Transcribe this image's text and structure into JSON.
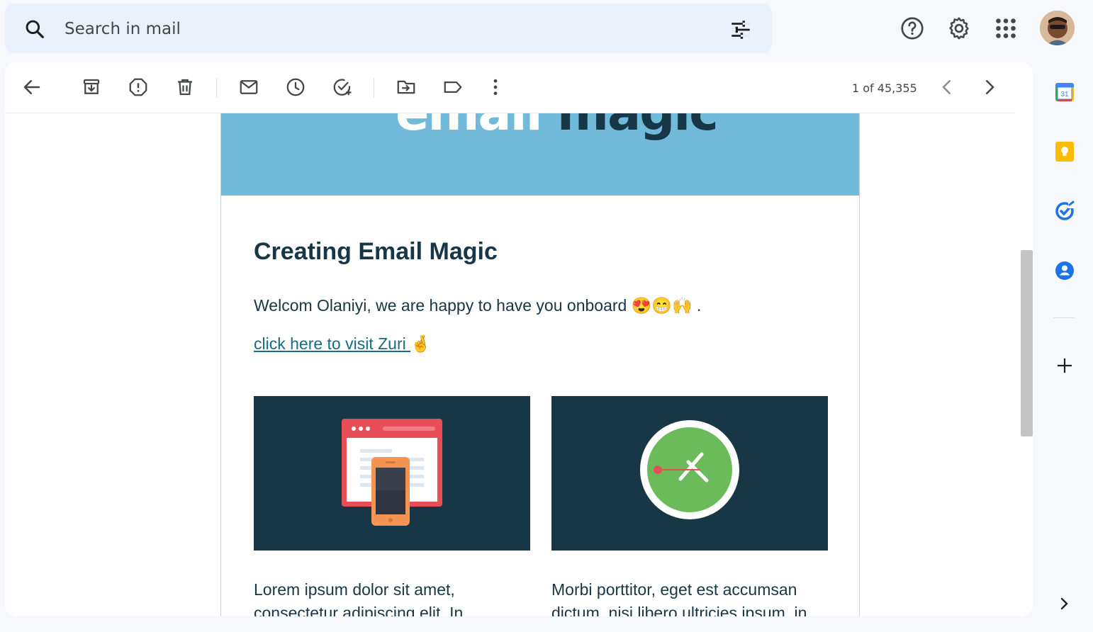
{
  "header": {
    "search_placeholder": "Search in mail",
    "icons": [
      "search-icon",
      "filter-options-icon",
      "help-icon",
      "settings-icon",
      "apps-grid-icon",
      "avatar"
    ]
  },
  "toolbar": {
    "pager_text": "1 of 45,355",
    "icons": [
      "back-arrow-icon",
      "archive-icon",
      "report-spam-icon",
      "delete-icon",
      "mark-unread-icon",
      "snooze-icon",
      "add-to-tasks-icon",
      "move-to-icon",
      "label-icon",
      "more-vert-icon",
      "prev-chevron-icon",
      "next-chevron-icon"
    ]
  },
  "email": {
    "banner": {
      "word_light": "email",
      "word_dark": "magic",
      "color": "#71bada"
    },
    "title": "Creating Email Magic",
    "welcome_text": "Welcom Olaniyi, we are happy to have you onboard 😍😁🙌 .",
    "link_text": "click here to visit Zuri ",
    "link_emoji": "🤞",
    "columns": [
      {
        "text": "Lorem ipsum dolor sit amet, consectetur adipiscing elit. In"
      },
      {
        "text": "Morbi porttitor, eget est accumsan dictum, nisi libero ultricies ipsum, in"
      }
    ],
    "tile_color": "#173746",
    "text_color": "#173746"
  },
  "side_panel": {
    "items": [
      "calendar-icon",
      "keep-icon",
      "tasks-icon",
      "contacts-icon",
      "add-addon-icon",
      "expand-panel-icon"
    ],
    "calendar_day": "31"
  }
}
